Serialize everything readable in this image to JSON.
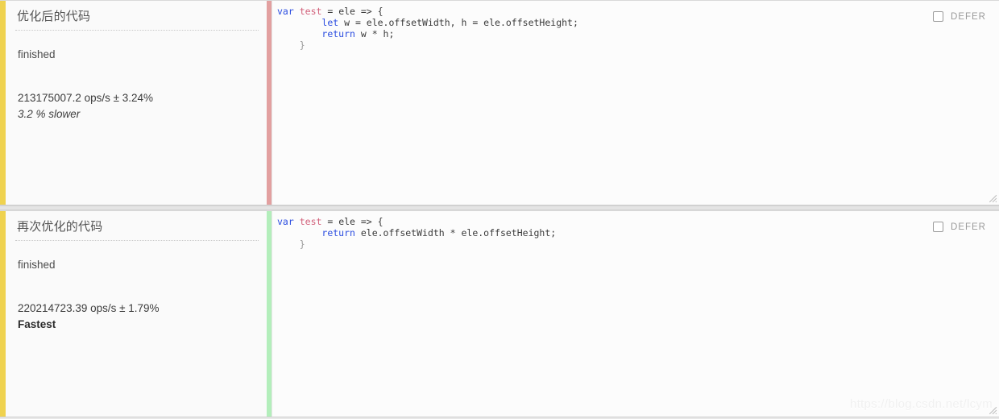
{
  "colors": {
    "accent_stripe": "#efd24f",
    "divider_slower": "#e2a0a0",
    "divider_fastest": "#b3eebb",
    "panel_background": "#fafafa",
    "code_background": "#fcfcfc",
    "page_background": "#e8e8e8",
    "keyword": "#2b4de0",
    "function_name": "#d2607a"
  },
  "watermark": {
    "text": "https://blog.csdn.net/lcym"
  },
  "defer": {
    "label": "DEFER",
    "checked": false
  },
  "panels": [
    {
      "title": "优化后的代码",
      "status": "finished",
      "ops": "213175007.2 ops/s ± 3.24%",
      "verdict": "3.2 % slower",
      "verdict_kind": "slower",
      "divider_color": "#e2a0a0",
      "code_lines": [
        [
          {
            "t": "var",
            "c": "kw"
          },
          {
            "t": " ",
            "c": "id"
          },
          {
            "t": "test",
            "c": "fn"
          },
          {
            "t": " = ele => {",
            "c": "id"
          }
        ],
        [
          {
            "t": "        ",
            "c": "id"
          },
          {
            "t": "let",
            "c": "kw"
          },
          {
            "t": " w = ele.offsetWidth, h = ele.offsetHeight;",
            "c": "id"
          }
        ],
        [
          {
            "t": "        ",
            "c": "id"
          },
          {
            "t": "return",
            "c": "kw"
          },
          {
            "t": " w * h;",
            "c": "id"
          }
        ],
        [
          {
            "t": "    }",
            "c": "punc"
          }
        ]
      ]
    },
    {
      "title": "再次优化的代码",
      "status": "finished",
      "ops": "220214723.39 ops/s ± 1.79%",
      "verdict": "Fastest",
      "verdict_kind": "fastest",
      "divider_color": "#b3eebb",
      "code_lines": [
        [
          {
            "t": "var",
            "c": "kw"
          },
          {
            "t": " ",
            "c": "id"
          },
          {
            "t": "test",
            "c": "fn"
          },
          {
            "t": " = ele => {",
            "c": "id"
          }
        ],
        [
          {
            "t": "        ",
            "c": "id"
          },
          {
            "t": "return",
            "c": "kw"
          },
          {
            "t": " ele.offsetWidth * ele.offsetHeight;",
            "c": "id"
          }
        ],
        [
          {
            "t": "    }",
            "c": "punc"
          }
        ]
      ]
    }
  ]
}
